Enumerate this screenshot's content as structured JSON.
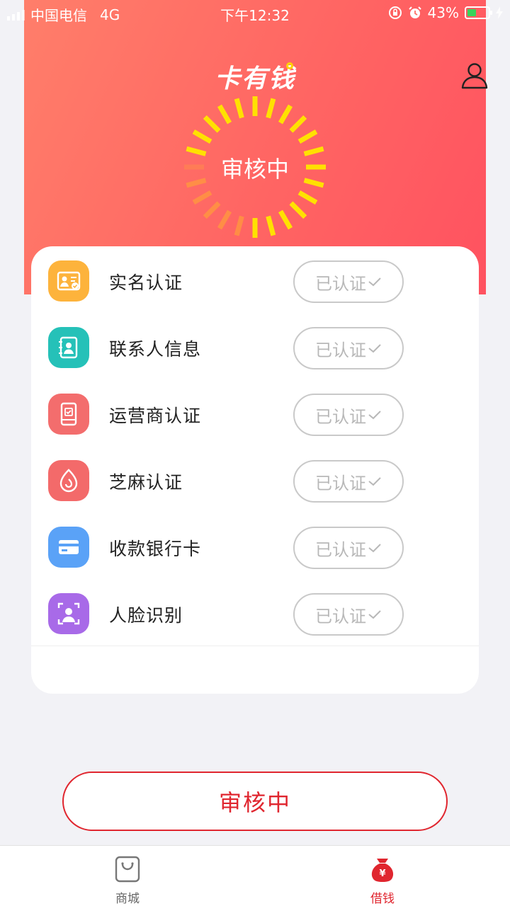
{
  "status_bar": {
    "carrier": "中国电信",
    "network": "4G",
    "time": "下午12:32",
    "battery_percent": "43%",
    "battery_level": 0.43
  },
  "header": {
    "logo": "卡有钱",
    "user_icon": "user-icon"
  },
  "status_indicator": {
    "text": "审核中",
    "color": "#ffe100"
  },
  "verification": {
    "items": [
      {
        "label": "实名认证",
        "status": "已认证",
        "icon": "id-card-icon",
        "color": "#fdb33c"
      },
      {
        "label": "联系人信息",
        "status": "已认证",
        "icon": "contacts-icon",
        "color": "#25c1b8"
      },
      {
        "label": "运营商认证",
        "status": "已认证",
        "icon": "phone-icon",
        "color": "#f36d6d"
      },
      {
        "label": "芝麻认证",
        "status": "已认证",
        "icon": "sesame-icon",
        "color": "#f36a6a"
      },
      {
        "label": "收款银行卡",
        "status": "已认证",
        "icon": "bank-card-icon",
        "color": "#5aa2f7"
      },
      {
        "label": "人脸识别",
        "status": "已认证",
        "icon": "face-scan-icon",
        "color": "#a86ae8"
      }
    ]
  },
  "primary_button": {
    "label": "审核中",
    "color": "#e0262f"
  },
  "tabbar": {
    "tabs": [
      {
        "label": "商城",
        "icon": "shopping-bag-icon",
        "active": false
      },
      {
        "label": "借钱",
        "icon": "money-bag-icon",
        "active": true
      }
    ],
    "active_color": "#e0262f",
    "inactive_color": "#666666"
  }
}
